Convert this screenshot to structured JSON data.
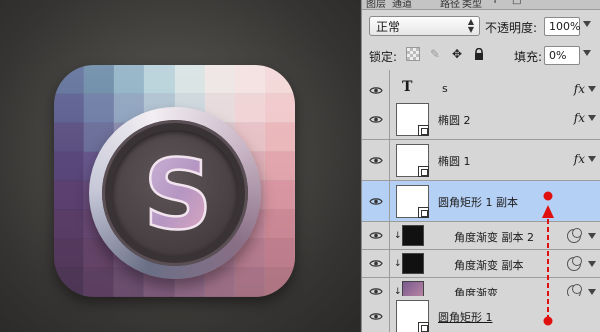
{
  "panel_tabs": [
    "图层",
    "通道",
    "路径",
    "类型",
    "T",
    "□"
  ],
  "options": {
    "blend_mode": "正常",
    "opacity_label": "不透明度:",
    "opacity_value": "100%",
    "lock_label": "锁定:",
    "fill_label": "填充:",
    "fill_value": "0%"
  },
  "layers": [
    {
      "name": "s",
      "kind": "text",
      "thumb_glyph": "T",
      "fx": "fx"
    },
    {
      "name": "椭圆 2",
      "kind": "shape",
      "fx": "fx"
    },
    {
      "name": "椭圆 1",
      "kind": "shape",
      "fx": "fx"
    },
    {
      "name": "圆角矩形 1 副本",
      "kind": "shape",
      "selected": true
    },
    {
      "name": "角度渐变 副本 2",
      "kind": "adjustment"
    },
    {
      "name": "角度渐变 副本",
      "kind": "adjustment"
    },
    {
      "name": "角度渐变",
      "kind": "adjustment"
    },
    {
      "name": "圆角矩形 1",
      "kind": "shape"
    }
  ],
  "canvas": {
    "badge_letter": "S",
    "tile_colors": [
      [
        "#5d6e98",
        "#6a89a6",
        "#8fb1c4",
        "#b6d0d8",
        "#d8e2e2",
        "#eee4e4",
        "#f4e0e0",
        "#f3d6d6"
      ],
      [
        "#5a5d8e",
        "#6c7aa4",
        "#8ea2be",
        "#aec0cf",
        "#ccd6dc",
        "#e6d9dc",
        "#efd2d4",
        "#f0c8ca"
      ],
      [
        "#5a4f80",
        "#6a6d98",
        "#8b8caf",
        "#aaa6bf",
        "#c9c0cc",
        "#dbc6cc",
        "#e6c0c4",
        "#eab6ba"
      ],
      [
        "#59467a",
        "#66568a",
        "#7f739e",
        "#9c8fb0",
        "#bca8bc",
        "#ceb0bc",
        "#dcaeb6",
        "#e2a6ae"
      ],
      [
        "#5d4172",
        "#6b4f80",
        "#806698",
        "#9a80aa",
        "#b696b2",
        "#c89cae",
        "#d49cab",
        "#dc98a4"
      ],
      [
        "#5c3f6a",
        "#6c4a76",
        "#7e5b88",
        "#97709a",
        "#ad84a2",
        "#bc8aa2",
        "#c98ca0",
        "#d28c9a"
      ],
      [
        "#583c62",
        "#6a476e",
        "#7a5780",
        "#90678e",
        "#a47896",
        "#b27e98",
        "#be8296",
        "#c88494"
      ],
      [
        "#533a5c",
        "#634468",
        "#735377",
        "#876184",
        "#9a7090",
        "#a87690",
        "#b27a8e",
        "#bc7e8c"
      ]
    ]
  }
}
